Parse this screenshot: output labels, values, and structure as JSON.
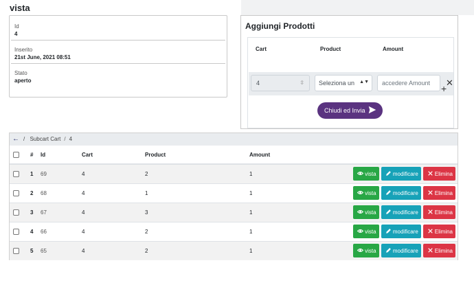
{
  "page": {
    "title": "vista"
  },
  "detail": [
    {
      "label": "Id",
      "value": "4"
    },
    {
      "label": "Inserito",
      "value": "21st June, 2021 08:51"
    },
    {
      "label": "Stato",
      "value": "aperto"
    }
  ],
  "add_panel": {
    "title": "Aggiungi Prodotti",
    "columns": {
      "cart": "Cart",
      "product": "Product",
      "amount": "Amount"
    },
    "row": {
      "cart_value": "4",
      "product_placeholder": "Seleziona un",
      "amount_placeholder": "accedere Amount"
    },
    "submit_label": "Chiudi ed Invia"
  },
  "breadcrumb": {
    "parent": "Subcart Cart",
    "current": "4"
  },
  "table": {
    "headers": {
      "num": "#",
      "id": "Id",
      "cart": "Cart",
      "product": "Product",
      "amount": "Amount"
    },
    "action_labels": {
      "view": "vista",
      "edit": "modificare",
      "delete": "Elimina"
    },
    "rows": [
      {
        "num": "1",
        "id": "69",
        "cart": "4",
        "product": "2",
        "amount": "1"
      },
      {
        "num": "2",
        "id": "68",
        "cart": "4",
        "product": "1",
        "amount": "1"
      },
      {
        "num": "3",
        "id": "67",
        "cart": "4",
        "product": "3",
        "amount": "1"
      },
      {
        "num": "4",
        "id": "66",
        "cart": "4",
        "product": "2",
        "amount": "1"
      },
      {
        "num": "5",
        "id": "65",
        "cart": "4",
        "product": "2",
        "amount": "1"
      }
    ]
  },
  "colors": {
    "submit": "#5a3380",
    "view": "#28a745",
    "edit": "#17a2b8",
    "delete": "#dc3545"
  }
}
